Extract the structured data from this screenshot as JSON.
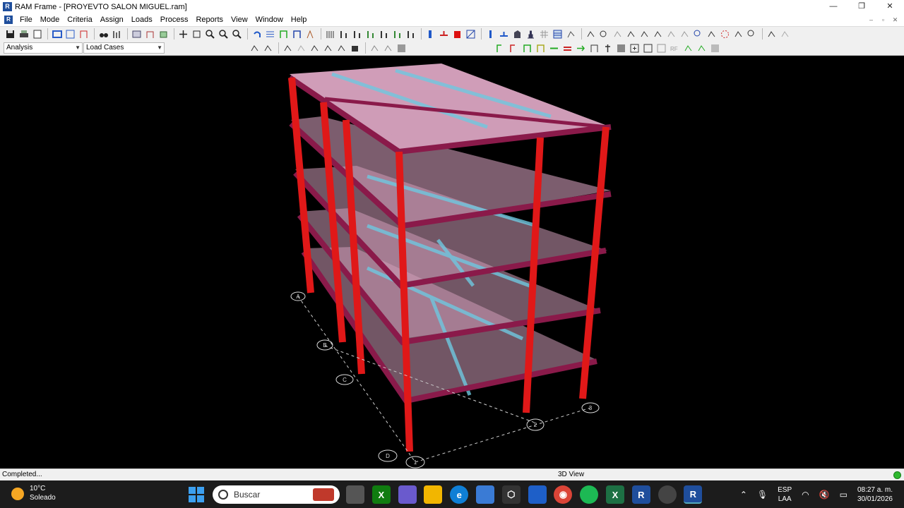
{
  "window": {
    "title": "RAM Frame - [PROYEVTO SALON MIGUEL.ram]",
    "app_icon": "ram-frame-icon",
    "controls": [
      "—",
      "❐",
      "✕"
    ]
  },
  "menubar": {
    "items": [
      "File",
      "Mode",
      "Criteria",
      "Assign",
      "Loads",
      "Process",
      "Reports",
      "View",
      "Window",
      "Help"
    ],
    "mdi_controls": [
      "–",
      "▫",
      "✕"
    ]
  },
  "toolbar": {
    "mode_combo": "Analysis",
    "loadcase_combo": "Load Cases"
  },
  "viewport": {
    "grid_bubbles_lettered": [
      "A",
      "B",
      "C",
      "D"
    ],
    "grid_bubbles_numbered": [
      "1",
      "2",
      "3"
    ],
    "colors": {
      "columns": "#e01818",
      "beams": "#8a1a4a",
      "slabs": "#f4b8d8",
      "joists": "#6fc8e0",
      "background": "#000000"
    }
  },
  "statusbar": {
    "left": "Completed...",
    "view": "3D View",
    "indicator_color": "#2eb82e"
  },
  "taskbar": {
    "weather_temp": "10°C",
    "weather_desc": "Soleado",
    "search_placeholder": "Buscar",
    "apps": [
      "task-view",
      "xbox",
      "copilot",
      "file-explorer",
      "edge",
      "store",
      "unity",
      "visual-studio",
      "chrome",
      "spotify",
      "excel",
      "ram-frame",
      "steam",
      "ram-frame-active"
    ],
    "lang_line1": "ESP",
    "lang_line2": "LAA",
    "time": "08:27 a. m.",
    "date": "30/01/2026"
  }
}
